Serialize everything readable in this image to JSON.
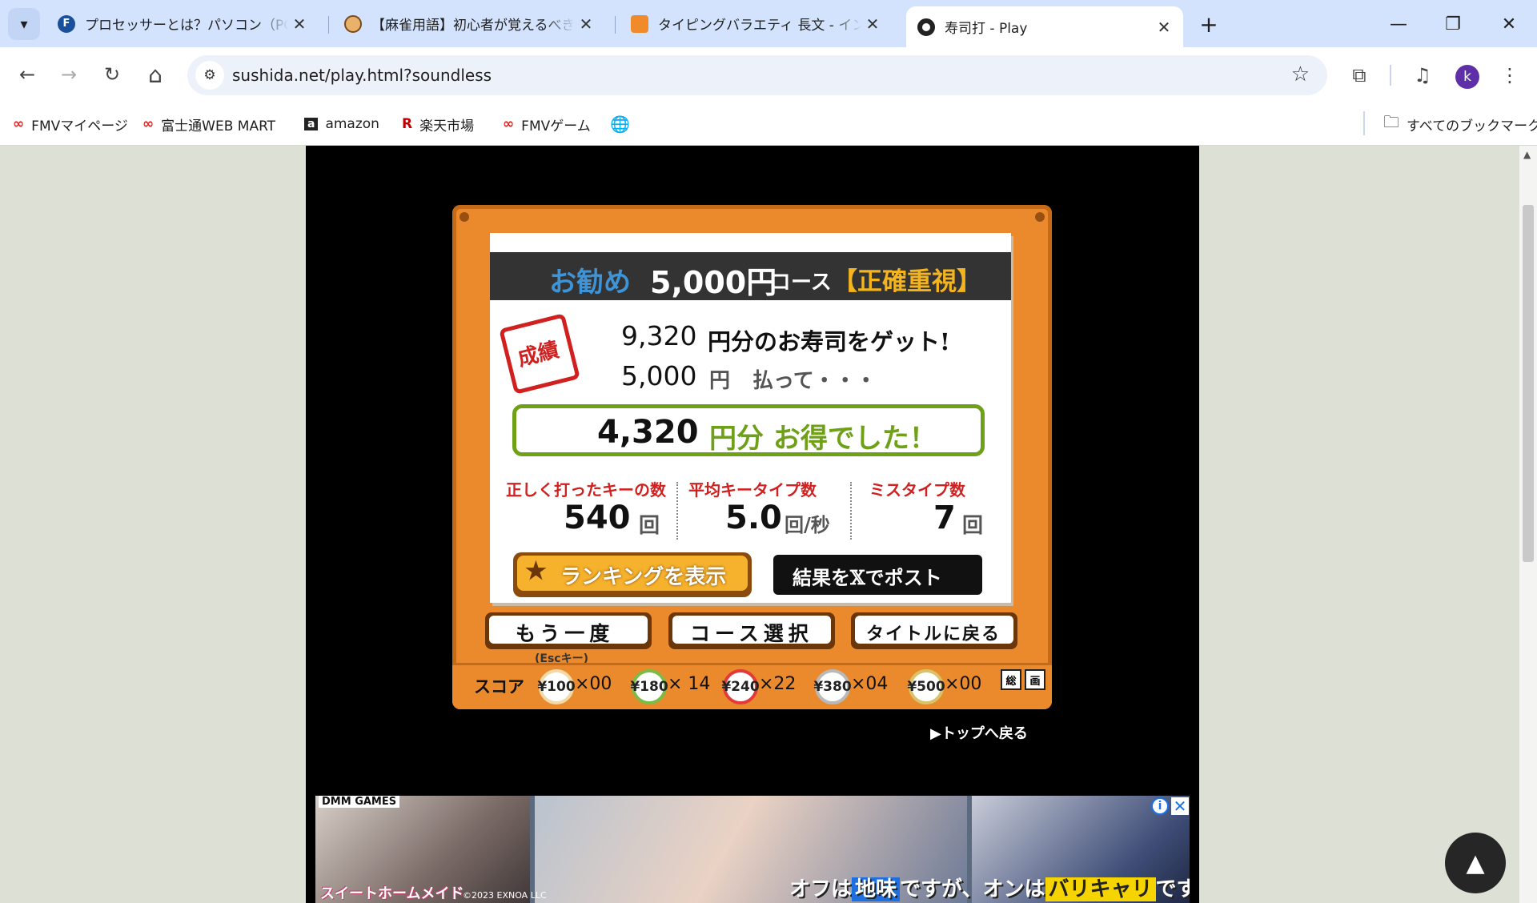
{
  "tabs": [
    {
      "title": "プロセッサーとは？パソコン（PC）の",
      "active": false
    },
    {
      "title": "【麻雀用語】初心者が覚えるべき基",
      "active": false
    },
    {
      "title": "タイピングバラエティ 長文 - インター",
      "active": false
    },
    {
      "title": "寿司打 - Play",
      "active": true
    }
  ],
  "icons": {
    "tab_search": "▾",
    "close": "✕",
    "new_tab": "+",
    "minimize": "—",
    "restore": "❐",
    "back": "←",
    "forward": "→",
    "reload": "↻",
    "home": "⌂",
    "site_info": "⚙",
    "bookmark_star": "☆",
    "extensions": "⧉",
    "media": "♫",
    "menu": "⋮",
    "folder": "🗀",
    "globe": "🌐",
    "scroll_up": "▲"
  },
  "address_bar": {
    "url": "sushida.net/play.html?soundless"
  },
  "profile_initial": "k",
  "bookmarks": [
    {
      "label": "FMVマイページ",
      "icon": "∞"
    },
    {
      "label": "富士通WEB MART",
      "icon": "∞"
    },
    {
      "label": "amazon",
      "icon": "a"
    },
    {
      "label": "楽天市場",
      "icon": "R"
    },
    {
      "label": "FMVゲーム",
      "icon": "∞"
    }
  ],
  "all_bookmarks": "すべてのブックマーク",
  "result": {
    "course_recommend": "お勧め",
    "course_price": "5,000円",
    "course_suffix": "コース",
    "course_mode": "【正確重視】",
    "stamp": "成績",
    "earned_amount": "9,320",
    "earned_text": "円分のお寿司をゲット!",
    "paid_amount": "5,000",
    "paid_unit": "円",
    "paid_text": "払って・・・",
    "profit_amount": "4,320",
    "profit_text": "円分 お得でした！",
    "correct_keys_label": "正しく打ったキーの数",
    "correct_keys": "540",
    "correct_keys_unit": "回",
    "avg_speed_label": "平均キータイプ数",
    "avg_speed": "5.0",
    "avg_speed_unit": "回/秒",
    "miss_label": "ミスタイプ数",
    "miss": "7",
    "miss_unit": "回"
  },
  "buttons": {
    "ranking": "ランキングを表示",
    "post": "結果を𝕏でポスト",
    "retry": "もう一度",
    "retry_hint": "(Escキー)",
    "course_select": "コース選択",
    "back_title": "タイトルに戻る",
    "back_top": "▶トップへ戻る"
  },
  "score": {
    "label": "スコア",
    "plates": [
      {
        "price": "¥100",
        "count": "×00",
        "color": "#f2d9a8"
      },
      {
        "price": "¥180",
        "count": "× 14",
        "color": "#7cbc44"
      },
      {
        "price": "¥240",
        "count": "×22",
        "color": "#e23a3a"
      },
      {
        "price": "¥380",
        "count": "×04",
        "color": "#b9b9b9"
      },
      {
        "price": "¥500",
        "count": "×00",
        "color": "#d9c36a"
      }
    ],
    "badge1": "総",
    "badge2": "画"
  },
  "ad": {
    "brand": "DMM GAMES",
    "game": "スイートホームメイド",
    "copyright": "©2023 EXNOA LLC",
    "caption_1": "オフは",
    "caption_hl_1": "地味",
    "caption_2": "ですが、オンは",
    "caption_hl_2": "バリキャリ",
    "caption_3": "です。",
    "info": "i",
    "close": "✕"
  },
  "scroll_top": "▲"
}
